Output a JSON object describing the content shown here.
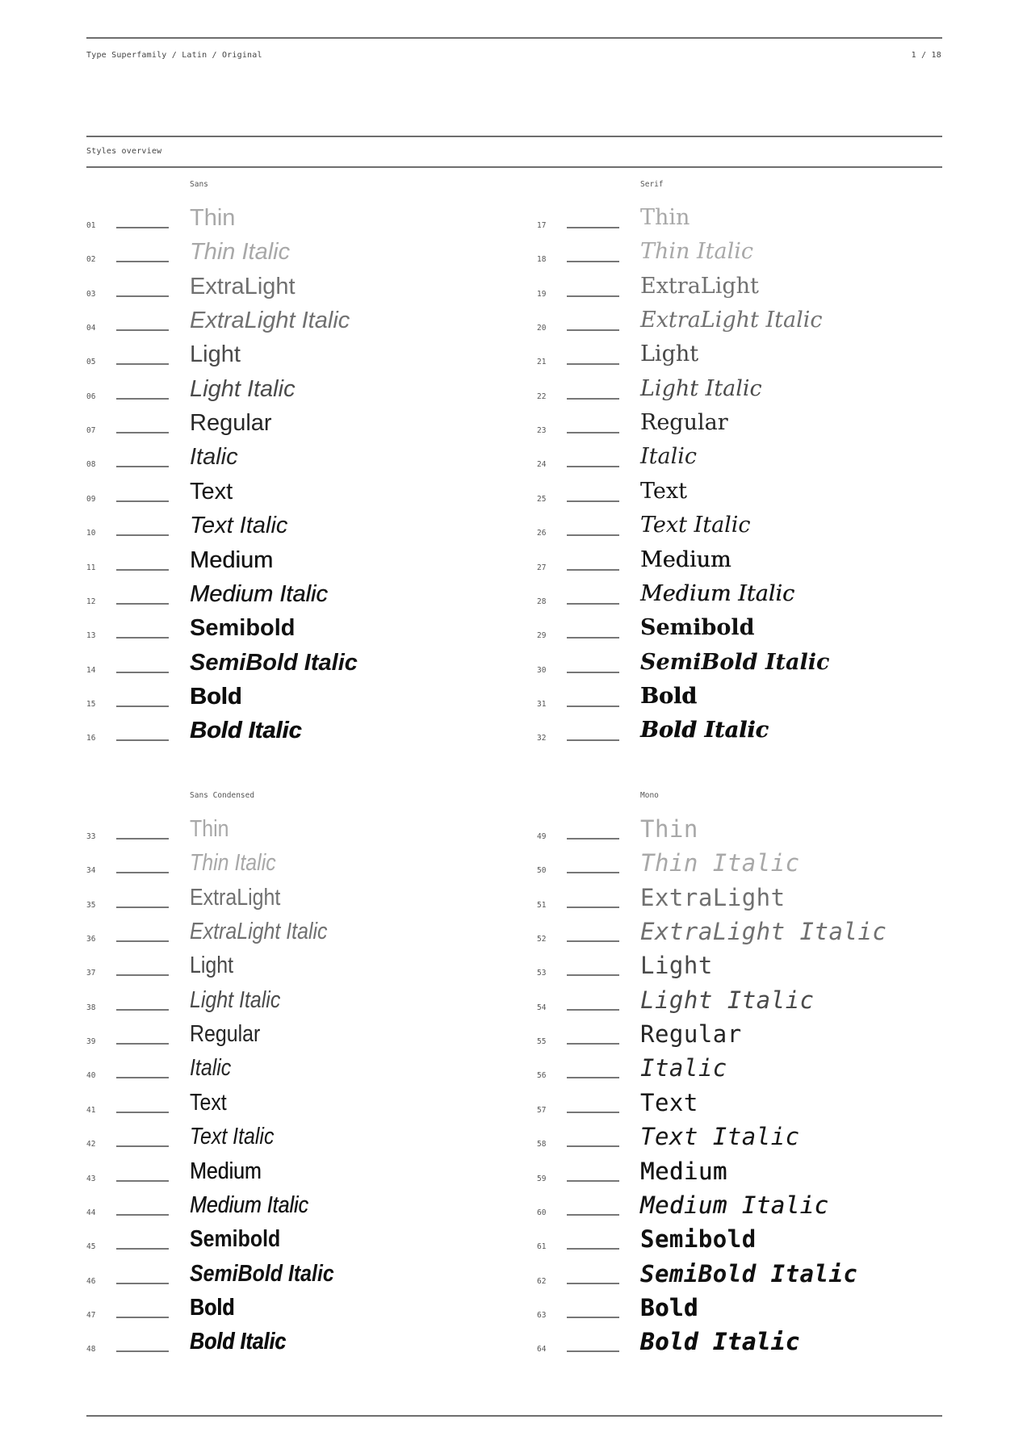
{
  "header": {
    "breadcrumb": "Type Superfamily / Latin / Original",
    "page_indicator": "1 / 18"
  },
  "section_title": "Styles overview",
  "families": [
    {
      "name": "Sans",
      "styles": [
        {
          "num": "01",
          "label": "Thin",
          "weight": "thin",
          "italic": false
        },
        {
          "num": "02",
          "label": "Thin Italic",
          "weight": "thin",
          "italic": true
        },
        {
          "num": "03",
          "label": "ExtraLight",
          "weight": "xlight",
          "italic": false
        },
        {
          "num": "04",
          "label": "ExtraLight Italic",
          "weight": "xlight",
          "italic": true
        },
        {
          "num": "05",
          "label": "Light",
          "weight": "light",
          "italic": false
        },
        {
          "num": "06",
          "label": "Light Italic",
          "weight": "light",
          "italic": true
        },
        {
          "num": "07",
          "label": "Regular",
          "weight": "regular",
          "italic": false
        },
        {
          "num": "08",
          "label": "Italic",
          "weight": "regular",
          "italic": true
        },
        {
          "num": "09",
          "label": "Text",
          "weight": "text",
          "italic": false
        },
        {
          "num": "10",
          "label": "Text Italic",
          "weight": "text",
          "italic": true
        },
        {
          "num": "11",
          "label": "Medium",
          "weight": "medium",
          "italic": false
        },
        {
          "num": "12",
          "label": "Medium Italic",
          "weight": "medium",
          "italic": true
        },
        {
          "num": "13",
          "label": "Semibold",
          "weight": "semibold",
          "italic": false
        },
        {
          "num": "14",
          "label": "SemiBold Italic",
          "weight": "semibold",
          "italic": true
        },
        {
          "num": "15",
          "label": "Bold",
          "weight": "bold",
          "italic": false
        },
        {
          "num": "16",
          "label": "Bold Italic",
          "weight": "bold",
          "italic": true
        }
      ]
    },
    {
      "name": "Serif",
      "styles": [
        {
          "num": "17",
          "label": "Thin",
          "weight": "thin",
          "italic": false
        },
        {
          "num": "18",
          "label": "Thin Italic",
          "weight": "thin",
          "italic": true
        },
        {
          "num": "19",
          "label": "ExtraLight",
          "weight": "xlight",
          "italic": false
        },
        {
          "num": "20",
          "label": "ExtraLight Italic",
          "weight": "xlight",
          "italic": true
        },
        {
          "num": "21",
          "label": "Light",
          "weight": "light",
          "italic": false
        },
        {
          "num": "22",
          "label": "Light Italic",
          "weight": "light",
          "italic": true
        },
        {
          "num": "23",
          "label": "Regular",
          "weight": "regular",
          "italic": false
        },
        {
          "num": "24",
          "label": "Italic",
          "weight": "regular",
          "italic": true
        },
        {
          "num": "25",
          "label": "Text",
          "weight": "text",
          "italic": false
        },
        {
          "num": "26",
          "label": "Text Italic",
          "weight": "text",
          "italic": true
        },
        {
          "num": "27",
          "label": "Medium",
          "weight": "medium",
          "italic": false
        },
        {
          "num": "28",
          "label": "Medium Italic",
          "weight": "medium",
          "italic": true
        },
        {
          "num": "29",
          "label": "Semibold",
          "weight": "semibold",
          "italic": false
        },
        {
          "num": "30",
          "label": "SemiBold Italic",
          "weight": "semibold",
          "italic": true
        },
        {
          "num": "31",
          "label": "Bold",
          "weight": "bold",
          "italic": false
        },
        {
          "num": "32",
          "label": "Bold Italic",
          "weight": "bold",
          "italic": true
        }
      ]
    },
    {
      "name": "Sans Condensed",
      "styles": [
        {
          "num": "33",
          "label": "Thin",
          "weight": "thin",
          "italic": false
        },
        {
          "num": "34",
          "label": "Thin Italic",
          "weight": "thin",
          "italic": true
        },
        {
          "num": "35",
          "label": "ExtraLight",
          "weight": "xlight",
          "italic": false
        },
        {
          "num": "36",
          "label": "ExtraLight Italic",
          "weight": "xlight",
          "italic": true
        },
        {
          "num": "37",
          "label": "Light",
          "weight": "light",
          "italic": false
        },
        {
          "num": "38",
          "label": "Light Italic",
          "weight": "light",
          "italic": true
        },
        {
          "num": "39",
          "label": "Regular",
          "weight": "regular",
          "italic": false
        },
        {
          "num": "40",
          "label": "Italic",
          "weight": "regular",
          "italic": true
        },
        {
          "num": "41",
          "label": "Text",
          "weight": "text",
          "italic": false
        },
        {
          "num": "42",
          "label": "Text Italic",
          "weight": "text",
          "italic": true
        },
        {
          "num": "43",
          "label": "Medium",
          "weight": "medium",
          "italic": false
        },
        {
          "num": "44",
          "label": "Medium Italic",
          "weight": "medium",
          "italic": true
        },
        {
          "num": "45",
          "label": "Semibold",
          "weight": "semibold",
          "italic": false
        },
        {
          "num": "46",
          "label": "SemiBold Italic",
          "weight": "semibold",
          "italic": true
        },
        {
          "num": "47",
          "label": "Bold",
          "weight": "bold",
          "italic": false
        },
        {
          "num": "48",
          "label": "Bold Italic",
          "weight": "bold",
          "italic": true
        }
      ]
    },
    {
      "name": "Mono",
      "styles": [
        {
          "num": "49",
          "label": "Thin",
          "weight": "thin",
          "italic": false
        },
        {
          "num": "50",
          "label": "Thin Italic",
          "weight": "thin",
          "italic": true
        },
        {
          "num": "51",
          "label": "ExtraLight",
          "weight": "xlight",
          "italic": false
        },
        {
          "num": "52",
          "label": "ExtraLight Italic",
          "weight": "xlight",
          "italic": true
        },
        {
          "num": "53",
          "label": "Light",
          "weight": "light",
          "italic": false
        },
        {
          "num": "54",
          "label": "Light Italic",
          "weight": "light",
          "italic": true
        },
        {
          "num": "55",
          "label": "Regular",
          "weight": "regular",
          "italic": false
        },
        {
          "num": "56",
          "label": "Italic",
          "weight": "regular",
          "italic": true
        },
        {
          "num": "57",
          "label": "Text",
          "weight": "text",
          "italic": false
        },
        {
          "num": "58",
          "label": "Text Italic",
          "weight": "text",
          "italic": true
        },
        {
          "num": "59",
          "label": "Medium",
          "weight": "medium",
          "italic": false
        },
        {
          "num": "60",
          "label": "Medium Italic",
          "weight": "medium",
          "italic": true
        },
        {
          "num": "61",
          "label": "Semibold",
          "weight": "semibold",
          "italic": false
        },
        {
          "num": "62",
          "label": "SemiBold Italic",
          "weight": "semibold",
          "italic": true
        },
        {
          "num": "63",
          "label": "Bold",
          "weight": "bold",
          "italic": false
        },
        {
          "num": "64",
          "label": "Bold Italic",
          "weight": "bold",
          "italic": true
        }
      ]
    }
  ]
}
